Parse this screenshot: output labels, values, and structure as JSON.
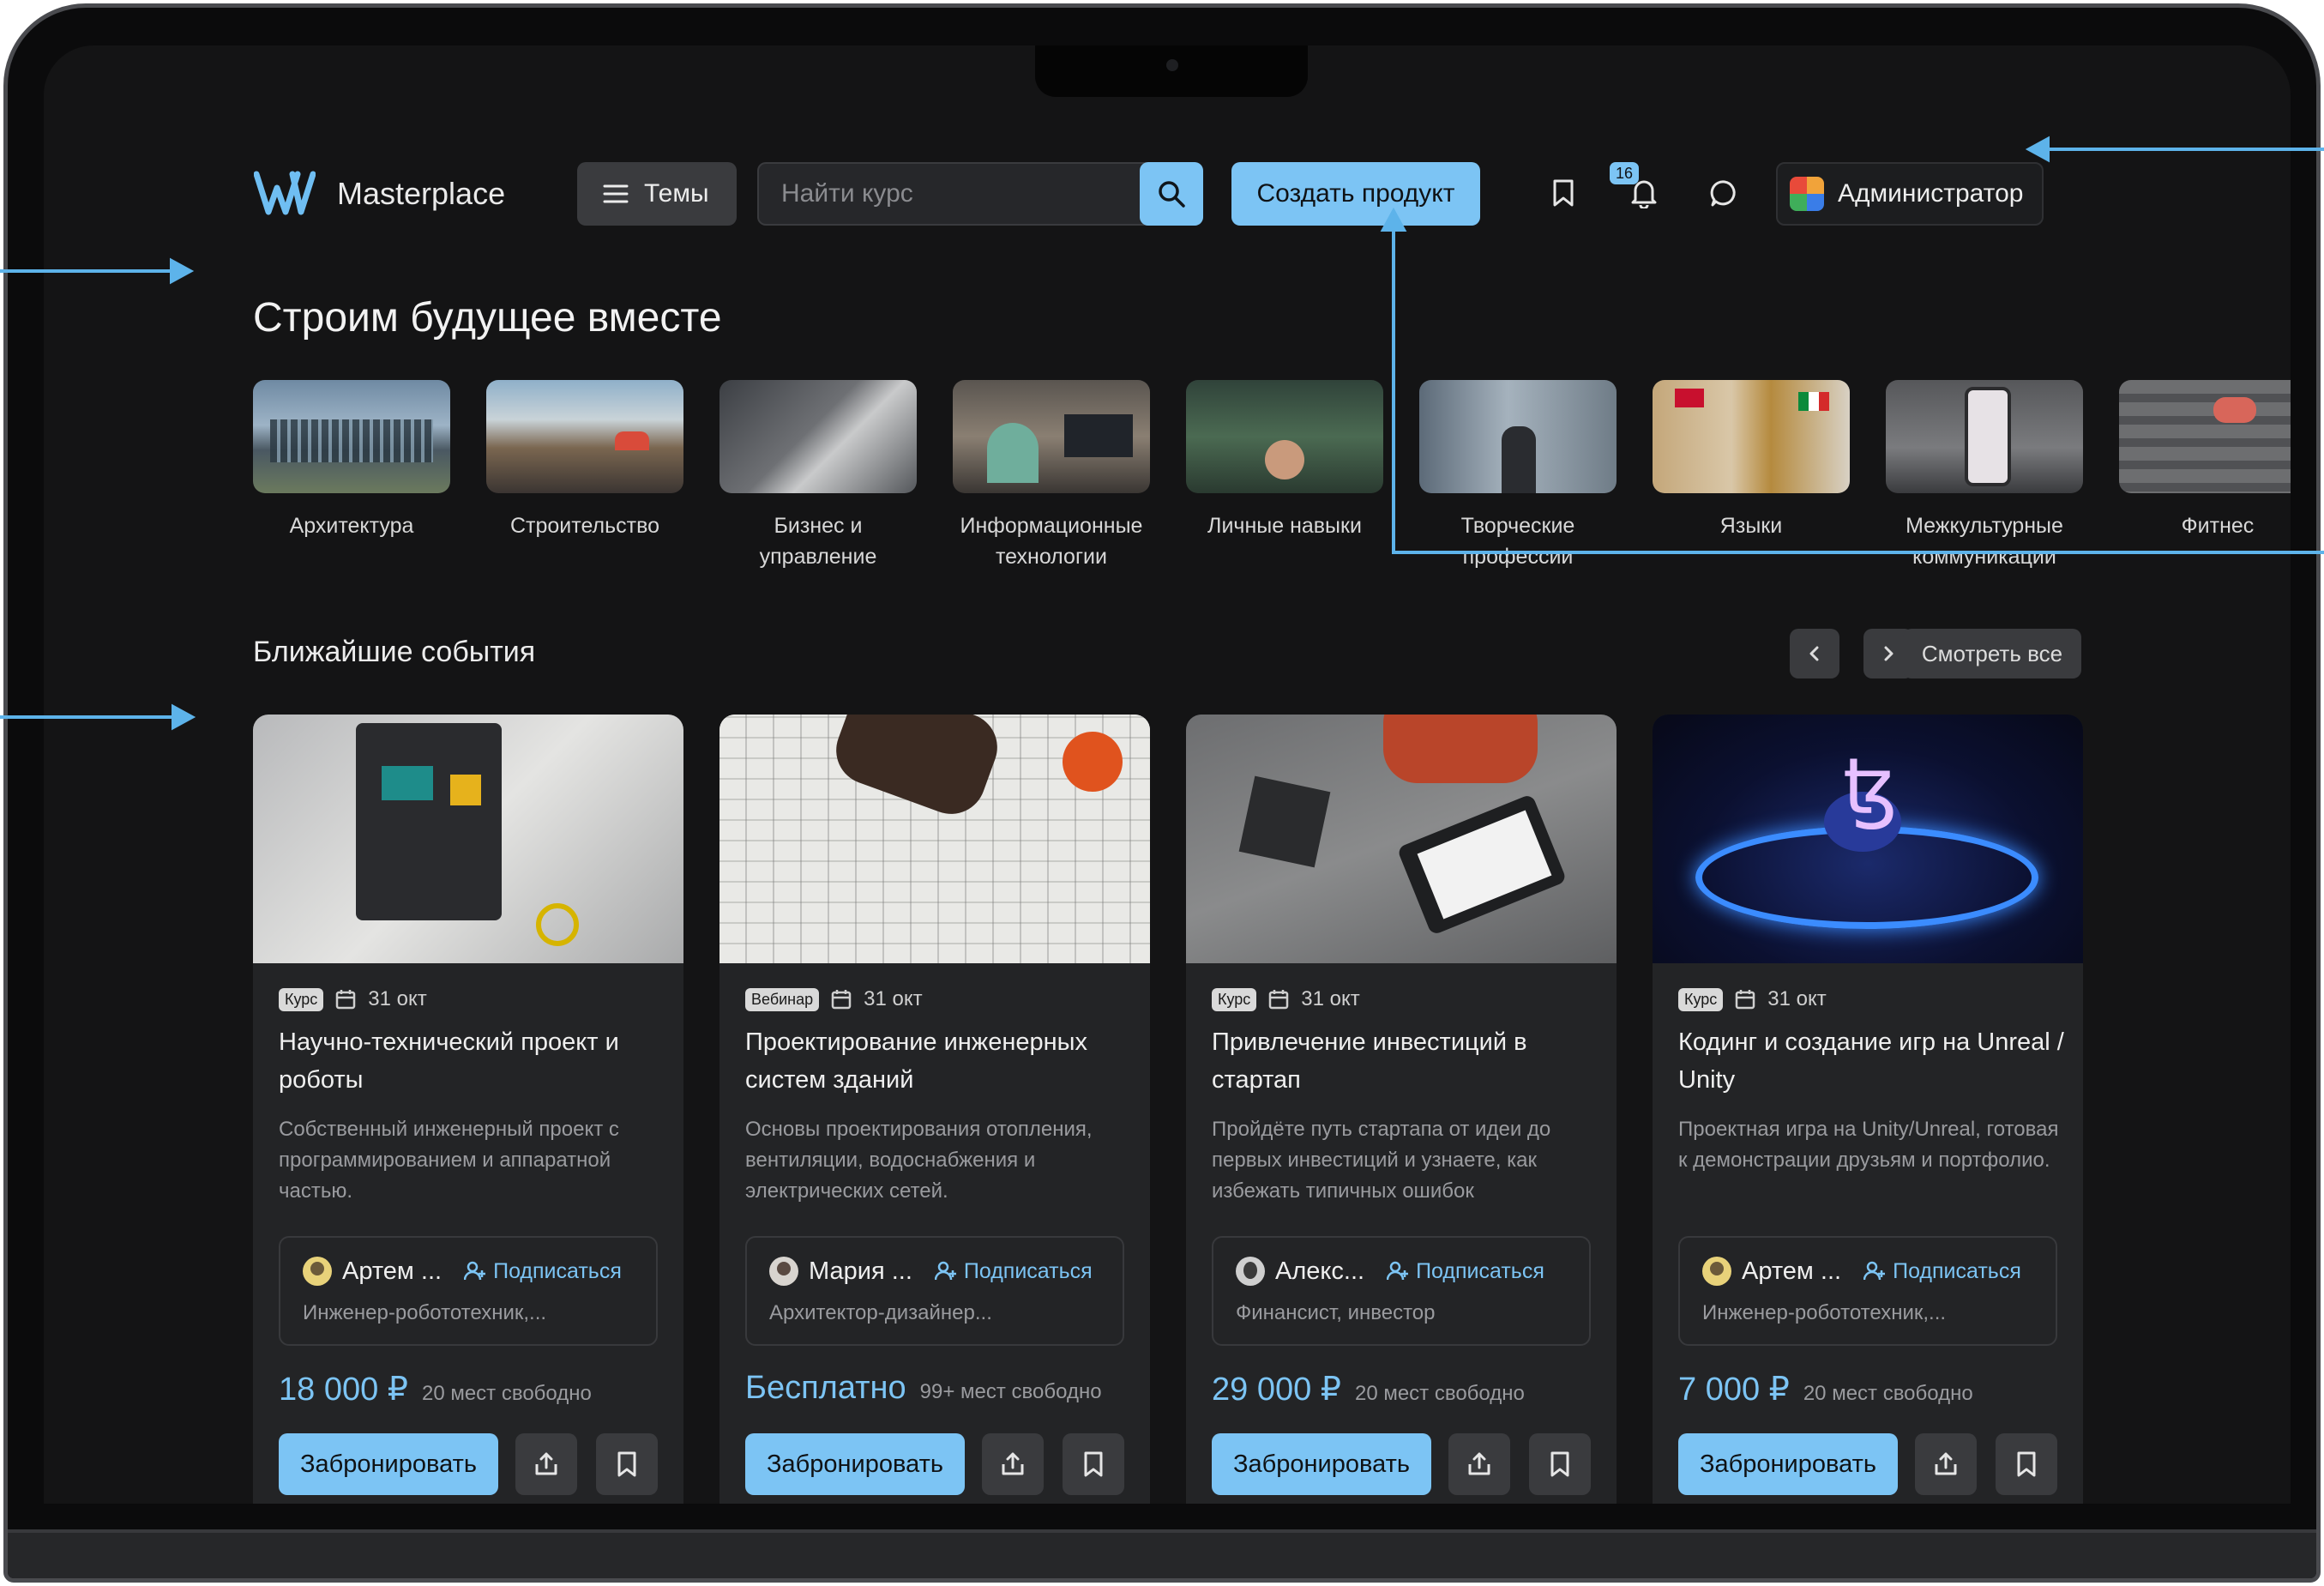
{
  "header": {
    "brand": "Masterplace",
    "themes_label": "Темы",
    "search_placeholder": "Найти курс",
    "create_label": "Создать продукт",
    "notifications_count": "16",
    "admin_label": "Администратор"
  },
  "hero": {
    "title": "Строим будущее вместе"
  },
  "categories": [
    {
      "label": "Архитектура"
    },
    {
      "label": "Строительство"
    },
    {
      "label": "Бизнес и управление"
    },
    {
      "label": "Информационные технологии"
    },
    {
      "label": "Личные навыки"
    },
    {
      "label": "Творческие профессии"
    },
    {
      "label": "Языки"
    },
    {
      "label": "Межкультурные коммуникации"
    },
    {
      "label": "Фитнес"
    }
  ],
  "events": {
    "title": "Ближайшие события",
    "see_all": "Смотреть все",
    "cards": [
      {
        "tag": "Курс",
        "date": "31 окт",
        "title": "Научно-технический проект и роботы",
        "desc": "Собственный инженерный проект с программированием и аппаратной частью.",
        "author": "Артем ...",
        "subscribe": "Подписаться",
        "role": "Инженер-робототехник,...",
        "price": "18 000 ₽",
        "seats": "20 мест свободно",
        "book": "Забронировать"
      },
      {
        "tag": "Вебинар",
        "date": "31 окт",
        "title": "Проектирование инженерных систем зданий",
        "desc": "Основы проектирования отопления, вентиляции, водоснабжения и электрических сетей.",
        "author": "Мария ...",
        "subscribe": "Подписаться",
        "role": "Архитектор-дизайнер...",
        "price": "Бесплатно",
        "seats": "99+ мест свободно",
        "book": "Забронировать"
      },
      {
        "tag": "Курс",
        "date": "31 окт",
        "title": "Привлечение инвестиций в стартап",
        "desc": "Пройдёте путь стартапа от идеи до первых инвестиций и узнаете, как избежать типичных ошибок",
        "author": "Алекс...",
        "subscribe": "Подписаться",
        "role": "Финансист, инвестор",
        "price": "29 000 ₽",
        "seats": "20 мест свободно",
        "book": "Забронировать"
      },
      {
        "tag": "Курс",
        "date": "31 окт",
        "title": "Кодинг и создание игр на Unreal / Unity",
        "desc": "Проектная игра на Unity/Unreal, готовая к демонстрации друзьям и портфолио.",
        "author": "Артем ...",
        "subscribe": "Подписаться",
        "role": "Инженер-робототехник,...",
        "price": "7 000 ₽",
        "seats": "20 мест свободно",
        "book": "Забронировать"
      }
    ]
  },
  "colors": {
    "accent": "#7cc4f4",
    "background": "#141415",
    "card": "#232426",
    "annotation": "#5db3ea"
  },
  "icons": [
    "logo-icon",
    "menu-icon",
    "search-icon",
    "bookmark-icon",
    "bell-icon",
    "chat-icon",
    "chevron-left-icon",
    "chevron-right-icon",
    "calendar-icon",
    "user-plus-icon",
    "share-icon"
  ]
}
